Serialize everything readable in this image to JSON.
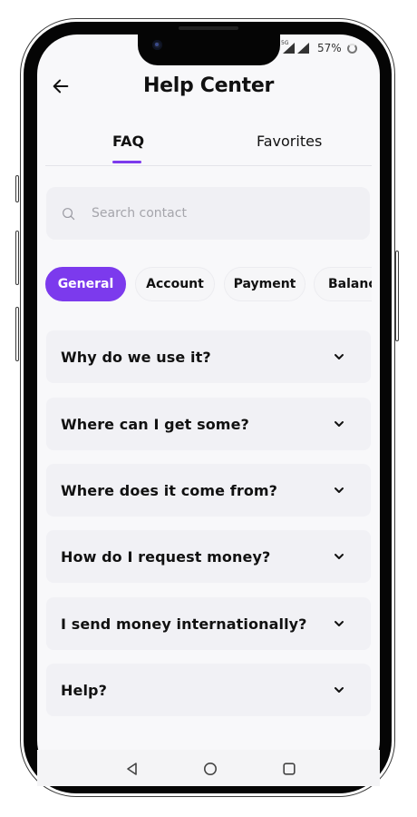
{
  "status_bar": {
    "signal_label": "5G",
    "battery_percent": "57%"
  },
  "header": {
    "title": "Help Center",
    "back_icon": "arrow-left-icon"
  },
  "tabs": [
    {
      "label": "FAQ",
      "active": true
    },
    {
      "label": "Favorites",
      "active": false
    }
  ],
  "search": {
    "placeholder": "Search contact",
    "value": ""
  },
  "categories": [
    {
      "label": "General",
      "active": true
    },
    {
      "label": "Account",
      "active": false
    },
    {
      "label": "Payment",
      "active": false
    },
    {
      "label": "Balanc",
      "active": false
    }
  ],
  "faqs": [
    {
      "question": "Why do we use it?"
    },
    {
      "question": "Where can I get some?"
    },
    {
      "question": "Where does it come from?"
    },
    {
      "question": "How do I request money?"
    },
    {
      "question": "I send money internationally?"
    },
    {
      "question": "Help?"
    }
  ],
  "colors": {
    "accent": "#7c3aed",
    "background": "#f8f8fa",
    "card": "#f1f1f5",
    "text": "#111111"
  },
  "nav": {
    "back_icon": "triangle-back-icon",
    "home_icon": "circle-home-icon",
    "recents_icon": "square-recents-icon"
  }
}
